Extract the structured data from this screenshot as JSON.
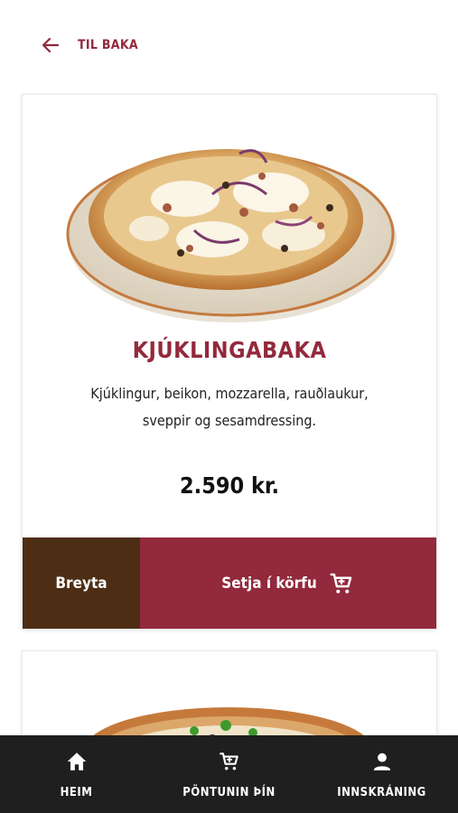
{
  "header": {
    "back_label": "TIL BAKA"
  },
  "product": {
    "name": "KJÚKLINGABAKA",
    "description_line1": "Kjúklingur, beikon, mozzarella, rauðlaukur,",
    "description_line2": "sveppir og sesamdressing.",
    "price": "2.590 kr.",
    "edit_label": "Breyta",
    "add_to_cart_label": "Setja í körfu"
  },
  "bottom_nav": {
    "home_label": "HEIM",
    "order_label": "PÖNTUNIN ÞÍN",
    "login_label": "INNSKRÁNING"
  },
  "colors": {
    "brand_red": "#93293c",
    "brown": "#4d2e14",
    "nav_bg": "#1f1f1f"
  },
  "icons": [
    "arrow-left-icon",
    "cart-icon",
    "home-icon",
    "user-icon"
  ]
}
